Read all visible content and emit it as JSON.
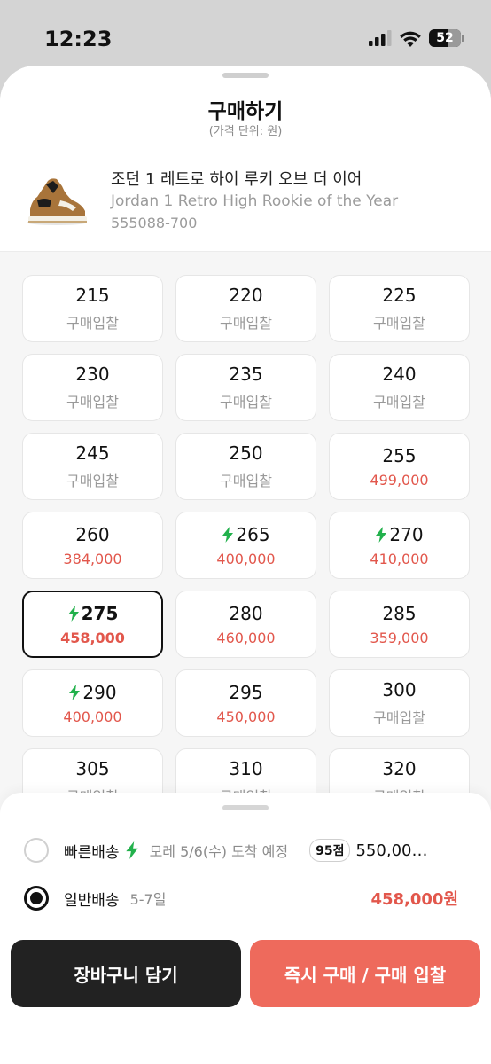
{
  "status_bar": {
    "time": "12:23",
    "battery": "52"
  },
  "header": {
    "title": "구매하기",
    "subtitle": "(가격 단위: 원)"
  },
  "product": {
    "name_ko": "조던 1 레트로 하이 루키 오브 더 이어",
    "name_en": "Jordan 1 Retro High Rookie of the Year",
    "code": "555088-700"
  },
  "sizes": [
    {
      "size": "215",
      "price": "구매입찰",
      "fast": false,
      "red": false,
      "selected": false
    },
    {
      "size": "220",
      "price": "구매입찰",
      "fast": false,
      "red": false,
      "selected": false
    },
    {
      "size": "225",
      "price": "구매입찰",
      "fast": false,
      "red": false,
      "selected": false
    },
    {
      "size": "230",
      "price": "구매입찰",
      "fast": false,
      "red": false,
      "selected": false
    },
    {
      "size": "235",
      "price": "구매입찰",
      "fast": false,
      "red": false,
      "selected": false
    },
    {
      "size": "240",
      "price": "구매입찰",
      "fast": false,
      "red": false,
      "selected": false
    },
    {
      "size": "245",
      "price": "구매입찰",
      "fast": false,
      "red": false,
      "selected": false
    },
    {
      "size": "250",
      "price": "구매입찰",
      "fast": false,
      "red": false,
      "selected": false
    },
    {
      "size": "255",
      "price": "499,000",
      "fast": false,
      "red": true,
      "selected": false
    },
    {
      "size": "260",
      "price": "384,000",
      "fast": false,
      "red": true,
      "selected": false
    },
    {
      "size": "265",
      "price": "400,000",
      "fast": true,
      "red": true,
      "selected": false
    },
    {
      "size": "270",
      "price": "410,000",
      "fast": true,
      "red": true,
      "selected": false
    },
    {
      "size": "275",
      "price": "458,000",
      "fast": true,
      "red": true,
      "selected": true
    },
    {
      "size": "280",
      "price": "460,000",
      "fast": false,
      "red": true,
      "selected": false
    },
    {
      "size": "285",
      "price": "359,000",
      "fast": false,
      "red": true,
      "selected": false
    },
    {
      "size": "290",
      "price": "400,000",
      "fast": true,
      "red": true,
      "selected": false
    },
    {
      "size": "295",
      "price": "450,000",
      "fast": false,
      "red": true,
      "selected": false
    },
    {
      "size": "300",
      "price": "구매입찰",
      "fast": false,
      "red": false,
      "selected": false
    },
    {
      "size": "305",
      "price": "구매입찰",
      "fast": false,
      "red": false,
      "selected": false
    },
    {
      "size": "310",
      "price": "구매입찰",
      "fast": false,
      "red": false,
      "selected": false
    },
    {
      "size": "320",
      "price": "구매입찰",
      "fast": false,
      "red": false,
      "selected": false
    }
  ],
  "delivery": {
    "fast": {
      "label": "빠른배송",
      "desc": "모레 5/6(수) 도착 예정",
      "score": "95점",
      "price": "550,00…"
    },
    "normal": {
      "label": "일반배송",
      "desc": "5-7일",
      "price": "458,000원"
    }
  },
  "buttons": {
    "cart": "장바구니 담기",
    "buy": "즉시 구매 / 구매 입찰"
  },
  "colors": {
    "accent_red": "#e2574c",
    "buy_button": "#ee6a5c",
    "bolt_green": "#22b14c"
  }
}
